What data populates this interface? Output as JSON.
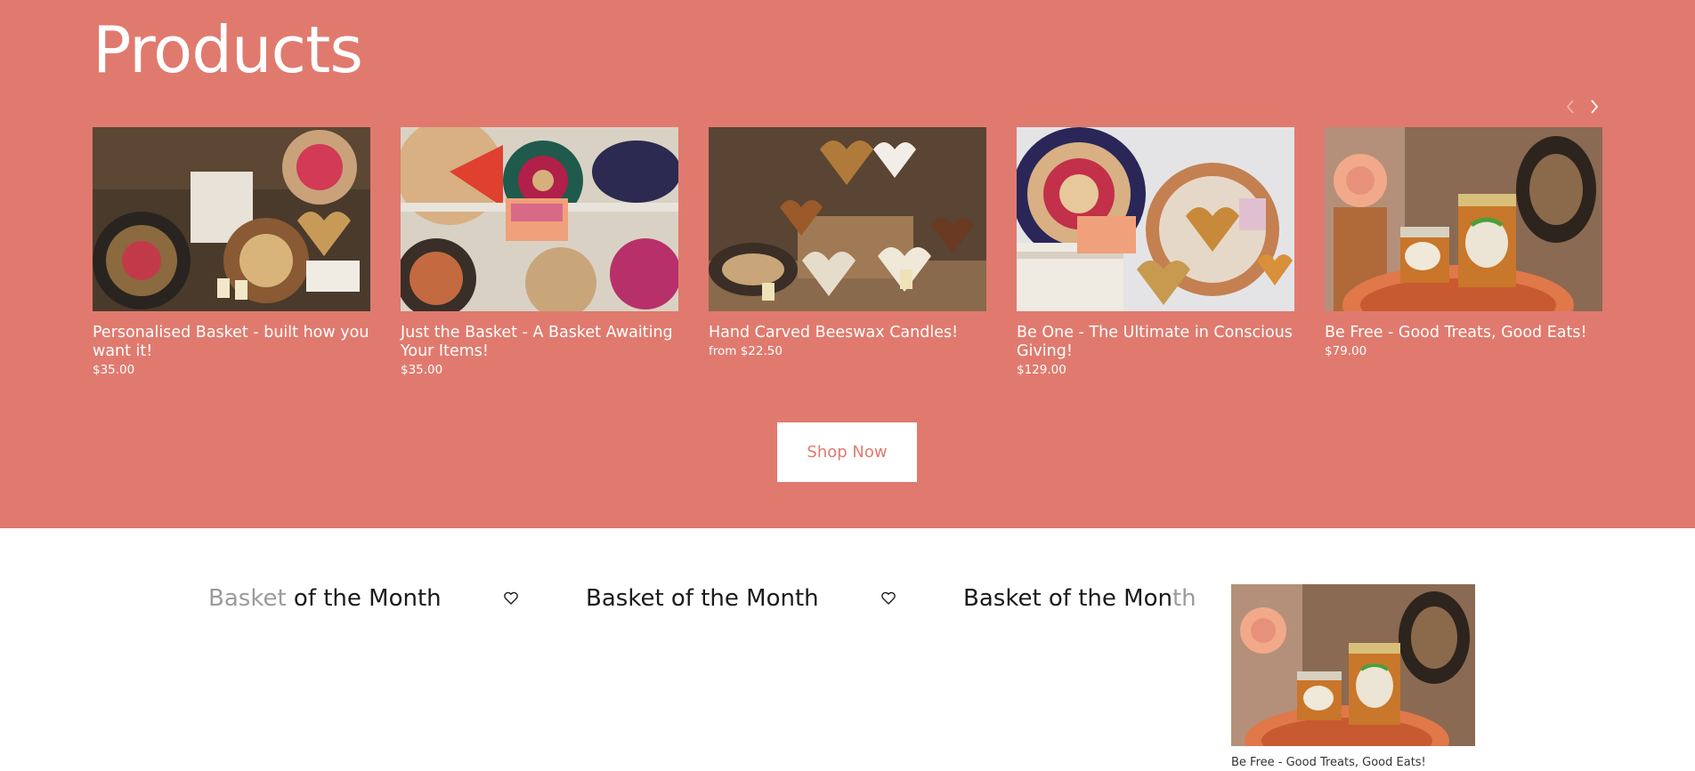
{
  "products_section": {
    "title": "Products",
    "shop_button": "Shop Now",
    "items": [
      {
        "name": "Personalised Basket - built how you want it!",
        "price": "$35.00"
      },
      {
        "name": "Just the Basket - A Basket Awaiting Your Items!",
        "price": "$35.00"
      },
      {
        "name": "Hand Carved Beeswax Candles!",
        "price": "from $22.50"
      },
      {
        "name": "Be One - The Ultimate in Conscious Giving!",
        "price": "$129.00"
      },
      {
        "name": "Be Free - Good Treats, Good Eats!",
        "price": "$79.00"
      }
    ]
  },
  "basket_of_month": {
    "items": [
      {
        "label_dim": "Basket",
        "label_rest": " of the Month"
      },
      {
        "label_dim": "",
        "label_rest": "Basket of the Month"
      },
      {
        "label_dim": "",
        "label_rest": "Basket of the Mon",
        "label_fade": "th"
      }
    ],
    "featured_caption": "Be Free - Good Treats, Good Eats!"
  },
  "colors": {
    "brand": "#e07a6e",
    "text_dark": "#1a1a1a",
    "white": "#ffffff"
  },
  "icons": [
    "chevron-left-icon",
    "chevron-right-icon",
    "heart-icon"
  ]
}
